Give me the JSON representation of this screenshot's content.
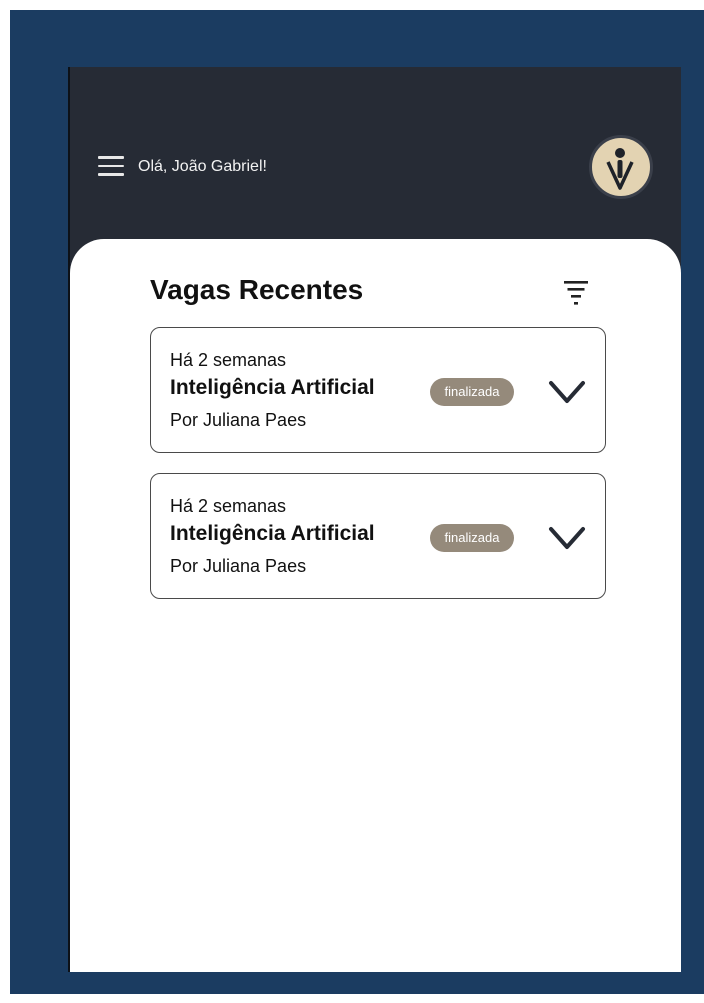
{
  "header": {
    "greeting": "Olá, João Gabriel!",
    "menu_icon": "hamburger-menu-icon",
    "avatar_icon": "user-logo-avatar"
  },
  "main": {
    "title": "Vagas Recentes",
    "filter_icon": "filter-icon",
    "cards": [
      {
        "time": "Há 2 semanas",
        "title": "Inteligência Artificial",
        "author": "Por Juliana Paes",
        "status": "finalizada"
      },
      {
        "time": "Há 2 semanas",
        "title": "Inteligência Artificial",
        "author": "Por Juliana Paes",
        "status": "finalizada"
      }
    ]
  },
  "colors": {
    "frame": "#1b3c61",
    "header_bg": "#262b35",
    "avatar_bg": "#e3d3b2",
    "badge_bg": "#958a7b",
    "content_bg": "#ffffff"
  }
}
